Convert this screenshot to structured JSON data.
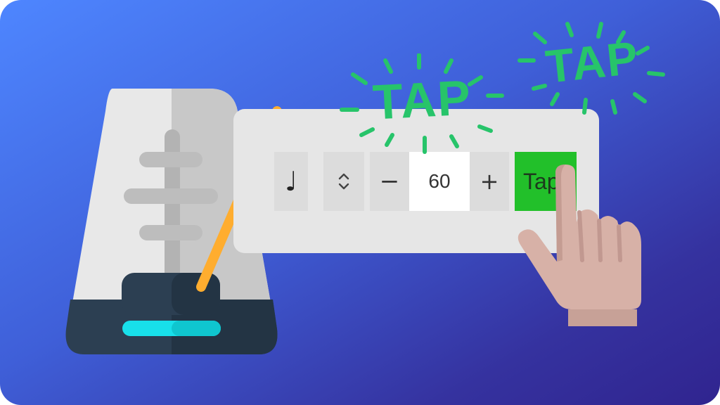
{
  "toolbar": {
    "note_icon": "quarter-note-icon",
    "note_glyph": "♩",
    "updown_icon": "up-down-chevron-icon",
    "updown_glyph": "⌃⌄",
    "minus_label": "−",
    "bpm_value": "60",
    "plus_label": "+",
    "tap_label": "Tap",
    "tap_color": "#22c02a"
  },
  "bursts": [
    {
      "word": "TAP"
    },
    {
      "word": "TAP"
    }
  ],
  "colors": {
    "background_start": "#4e86ff",
    "background_end": "#30248f",
    "burst_green": "#27c46a",
    "pendulum_bob": "#ff6b63",
    "pendulum_arm": "#ffad2f",
    "light_strip": "#18e0ea"
  }
}
